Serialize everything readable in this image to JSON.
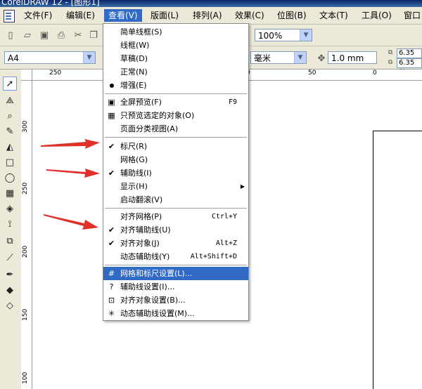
{
  "window": {
    "title": "CorelDRAW 12 - [图形1]"
  },
  "menubar": {
    "items": [
      {
        "label": "文件(F)"
      },
      {
        "label": "编辑(E)"
      },
      {
        "label": "查看(V)"
      },
      {
        "label": "版面(L)"
      },
      {
        "label": "排列(A)"
      },
      {
        "label": "效果(C)"
      },
      {
        "label": "位图(B)"
      },
      {
        "label": "文本(T)"
      },
      {
        "label": "工具(O)"
      },
      {
        "label": "窗口"
      }
    ]
  },
  "toolbar": {
    "zoom_value": "100%"
  },
  "property_bar": {
    "paper_size": "A4",
    "units": "毫米",
    "nudge": "1.0 mm",
    "dup_x": "6.35 m",
    "dup_y": "6.35 m"
  },
  "rulers": {
    "horizontal": [
      "250",
      "0",
      "50",
      "0"
    ],
    "vertical": [
      "300",
      "250",
      "200",
      "150",
      "100"
    ]
  },
  "view_menu": {
    "items": [
      {
        "label": "简单线框(S)"
      },
      {
        "label": "线框(W)"
      },
      {
        "label": "草稿(D)"
      },
      {
        "label": "正常(N)"
      },
      {
        "label": "增强(E)"
      },
      {
        "label": "全屏预览(F)",
        "shortcut": "F9"
      },
      {
        "label": "只预览选定的对象(O)"
      },
      {
        "label": "页面分类视图(A)"
      },
      {
        "label": "标尺(R)"
      },
      {
        "label": "网格(G)"
      },
      {
        "label": "辅助线(I)"
      },
      {
        "label": "显示(H)"
      },
      {
        "label": "启动翻滚(V)"
      },
      {
        "label": "对齐网格(P)",
        "shortcut": "Ctrl+Y"
      },
      {
        "label": "对齐辅助线(U)"
      },
      {
        "label": "对齐对象(J)",
        "shortcut": "Alt+Z"
      },
      {
        "label": "动态辅助线(Y)",
        "shortcut": "Alt+Shift+D"
      },
      {
        "label": "网格和标尺设置(L)..."
      },
      {
        "label": "辅助线设置(I)..."
      },
      {
        "label": "对齐对象设置(B)..."
      },
      {
        "label": "动态辅助线设置(M)..."
      }
    ]
  },
  "colors": {
    "highlight": "#316ac5",
    "arrow": "#e0302a",
    "menubar_bg": "#ece9d8"
  },
  "icons": [
    "check-icon",
    "radio-dot-icon",
    "fullscreen-icon",
    "grid-icon",
    "submenu-arrow-icon"
  ]
}
